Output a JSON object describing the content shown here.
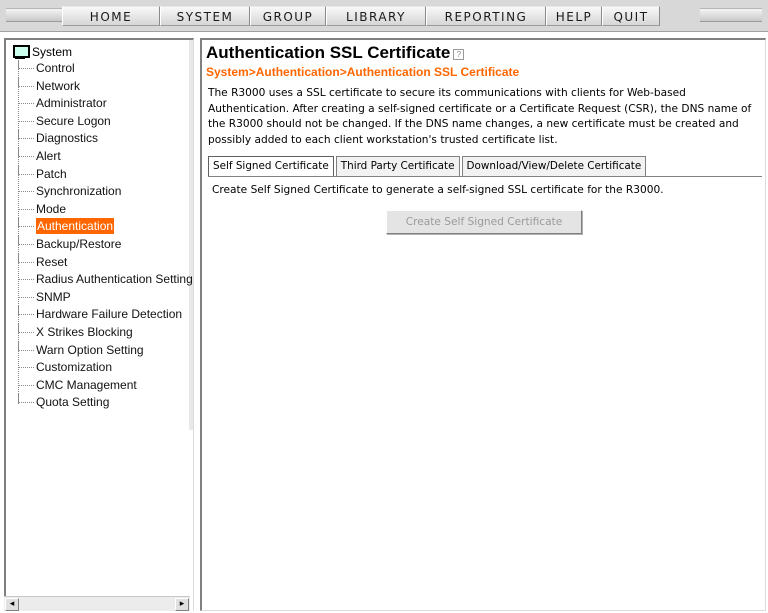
{
  "menu": {
    "items": [
      "HOME",
      "SYSTEM",
      "GROUP",
      "LIBRARY",
      "REPORTING",
      "HELP",
      "QUIT"
    ]
  },
  "tree": {
    "root_label": "System",
    "items": [
      "Control",
      "Network",
      "Administrator",
      "Secure Logon",
      "Diagnostics",
      "Alert",
      "Patch",
      "Synchronization",
      "Mode",
      "Authentication",
      "Backup/Restore",
      "Reset",
      "Radius Authentication Setting",
      "SNMP",
      "Hardware Failure Detection",
      "X Strikes Blocking",
      "Warn Option Setting",
      "Customization",
      "CMC Management",
      "Quota Setting"
    ],
    "selected": "Authentication"
  },
  "scroll": {
    "left_arrow": "◂",
    "right_arrow": "▸"
  },
  "content": {
    "title": "Authentication SSL Certificate",
    "help_glyph": "?",
    "breadcrumb": "System>Authentication>Authentication SSL Certificate",
    "description": "The R3000 uses a SSL certificate to secure its communications with clients for Web-based Authentication. After creating a self-signed certificate or a Certificate Request (CSR), the DNS name of the R3000 should not be changed. If the DNS name changes, a new certificate must be created and possibly added to each client workstation's trusted certificate list.",
    "tabs": [
      "Self Signed Certificate",
      "Third Party Certificate",
      "Download/View/Delete Certificate"
    ],
    "active_tab": "Self Signed Certificate",
    "panel_text": "Create Self Signed Certificate to generate a self-signed SSL certificate for the R3000.",
    "create_button": "Create Self Signed Certificate"
  },
  "colors": {
    "accent": "#ff6600",
    "selected_bg": "#ff6600"
  }
}
